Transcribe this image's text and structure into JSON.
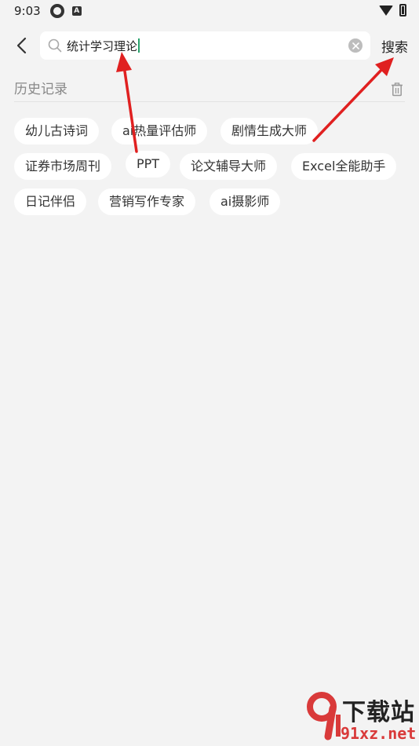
{
  "status_bar": {
    "time": "9:03",
    "icons": [
      "settings-like-icon",
      "text-a-icon",
      "wifi-icon",
      "battery-icon"
    ],
    "badge_letter": "A"
  },
  "search": {
    "query": "统计学习理论",
    "submit_label": "搜索"
  },
  "history": {
    "title": "历史记录",
    "tags": [
      "幼儿古诗词",
      "ai热量评估师",
      "剧情生成大师",
      "证券市场周刊",
      "PPT",
      "论文辅导大师",
      "Excel全能助手",
      "日记伴侣",
      "营销写作专家",
      "ai摄影师"
    ]
  },
  "watermark": {
    "top": "下载站",
    "bottom": "91xz.net"
  },
  "colors": {
    "background": "#f3f3f3",
    "tag_bg": "#ffffff",
    "arrow": "#e02020",
    "cursor": "#27a16b"
  }
}
